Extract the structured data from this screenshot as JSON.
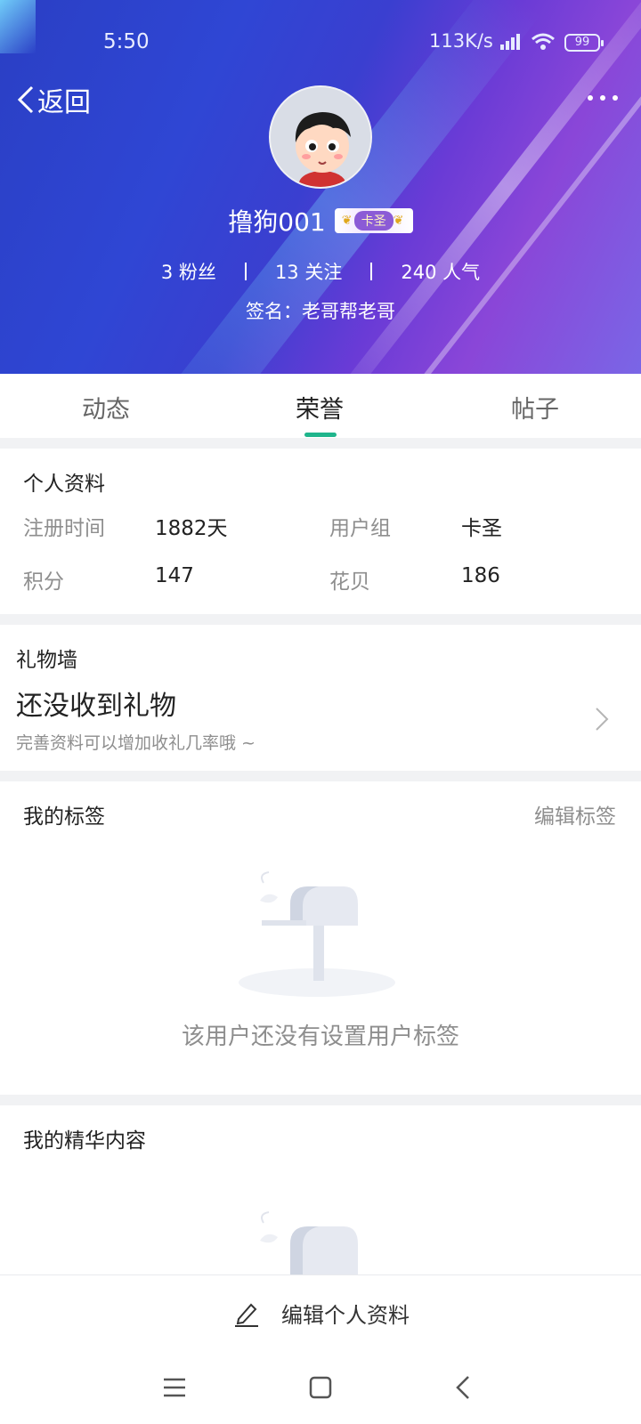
{
  "status_bar": {
    "time": "5:50",
    "network": "113K/s",
    "battery": "99"
  },
  "header": {
    "back_label": "返回",
    "more_icon": "more-horizontal-icon",
    "username": "撸狗001",
    "badge": "卡圣",
    "stats": [
      {
        "label": "3 粉丝"
      },
      {
        "label": "13 关注"
      },
      {
        "label": "240 人气"
      }
    ],
    "signature": "签名：老哥帮老哥"
  },
  "tabs": [
    {
      "label": "动态",
      "active": false
    },
    {
      "label": "荣誉",
      "active": true
    },
    {
      "label": "帖子",
      "active": false
    }
  ],
  "profile": {
    "title": "个人资料",
    "fields": [
      {
        "label": "注册时间",
        "value": "1882天"
      },
      {
        "label": "用户组",
        "value": "卡圣"
      },
      {
        "label": "积分",
        "value": "147"
      },
      {
        "label": "花贝",
        "value": "186"
      }
    ]
  },
  "gift_wall": {
    "title": "礼物墙",
    "headline": "还没收到礼物",
    "subtext": "完善资料可以增加收礼几率哦 ~"
  },
  "tags": {
    "title": "我的标签",
    "edit_label": "编辑标签",
    "empty_text": "该用户还没有设置用户标签"
  },
  "featured": {
    "title": "我的精华内容"
  },
  "bottom_bar": {
    "edit_profile_label": "编辑个人资料"
  },
  "colors": {
    "accent": "#1fb58c",
    "header_blue": "#2f46d4",
    "header_purple": "#8a46d8"
  }
}
